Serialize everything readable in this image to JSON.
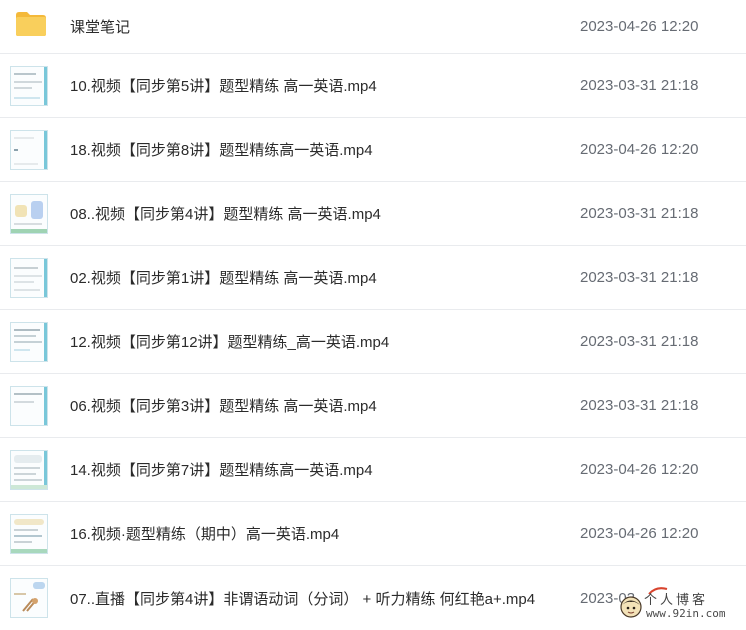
{
  "files": [
    {
      "name": "课堂笔记",
      "date": "2023-04-26 12:20",
      "icon": "folder-icon"
    },
    {
      "name": "10.视频【同步第5讲】题型精练 高一英语.mp4",
      "date": "2023-03-31 21:18",
      "icon": "video-thumbnail"
    },
    {
      "name": "18.视频【同步第8讲】题型精练高一英语.mp4",
      "date": "2023-04-26 12:20",
      "icon": "video-thumbnail"
    },
    {
      "name": "08..视频【同步第4讲】题型精练 高一英语.mp4",
      "date": "2023-03-31 21:18",
      "icon": "video-thumbnail"
    },
    {
      "name": "02.视频【同步第1讲】题型精练 高一英语.mp4",
      "date": "2023-03-31 21:18",
      "icon": "video-thumbnail"
    },
    {
      "name": "12.视频【同步第12讲】题型精练_高一英语.mp4",
      "date": "2023-03-31 21:18",
      "icon": "video-thumbnail"
    },
    {
      "name": "06.视频【同步第3讲】题型精练 高一英语.mp4",
      "date": "2023-03-31 21:18",
      "icon": "video-thumbnail"
    },
    {
      "name": "14.视频【同步第7讲】题型精练高一英语.mp4",
      "date": "2023-04-26 12:20",
      "icon": "video-thumbnail"
    },
    {
      "name": "16.视频·题型精练（期中）高一英语.mp4",
      "date": "2023-04-26 12:20",
      "icon": "video-thumbnail"
    },
    {
      "name": "07..直播【同步第4讲】非谓语动词（分词） + 听力精练 何红艳a+.mp4",
      "date": "2023-03",
      "icon": "video-thumbnail"
    }
  ],
  "watermark": {
    "text": "个人博客",
    "url": "www.92in.com"
  },
  "colors": {
    "folder": "#f7c64a",
    "divider": "#e9ebee",
    "date_text": "#666b73",
    "name_text": "#2b2b2b"
  }
}
